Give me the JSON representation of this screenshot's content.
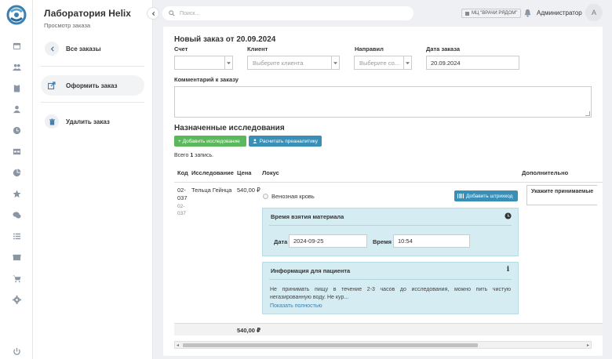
{
  "app": {
    "title": "Лаборатория Helix",
    "subtitle": "Просмотр заказа",
    "brand_color": "#3a7fb0"
  },
  "rail": {
    "icons": [
      "calendar-icon",
      "users-icon",
      "clipboard-icon",
      "user-icon",
      "clock-icon",
      "table-icon",
      "pie-chart-icon",
      "star-icon",
      "chat-icon",
      "list-icon",
      "box-icon",
      "cart-icon",
      "gear-icon",
      "power-icon"
    ]
  },
  "sidebar": {
    "back_label": "Все заказы",
    "submit_label": "Оформить заказ",
    "delete_label": "Удалить заказ"
  },
  "topbar": {
    "search_placeholder": "Поиск...",
    "org_label": "МЦ \"ВРАЧИ РЯДОМ\"",
    "user_name": "Администратор",
    "avatar_letter": "А"
  },
  "order": {
    "title": "Новый заказ от 20.09.2024",
    "fields": {
      "account_label": "Счет",
      "account_value": "",
      "client_label": "Клиент",
      "client_placeholder": "Выберите клиента",
      "referrer_label": "Направил",
      "referrer_placeholder": "Выберите со...",
      "date_label": "Дата заказа",
      "date_value": "20.09.2024",
      "comment_label": "Комментарий к заказу"
    },
    "section_title": "Назначенные исследования",
    "add_study_button": "+ Добавить исследование",
    "preanalytics_button": "Расчитать преаналитику",
    "count_prefix": "Всего ",
    "count_value": "1",
    "count_suffix": " запись."
  },
  "table": {
    "columns": [
      "Код",
      "Исследование",
      "Цена",
      "Локус",
      "Дополнительно"
    ],
    "row": {
      "code_line1": "02-",
      "code_line2": "037",
      "code_sub1": "02-",
      "code_sub2": "037",
      "study": "Тельца Гейнца",
      "price": "540,00 ₽",
      "locus": "Венозная кровь",
      "barcode_button": "Добавить штрихкод",
      "extra": "Укажите принимаемые"
    },
    "total": "540,00 ₽"
  },
  "sample_panel": {
    "title": "Время взятия материала",
    "date_label": "Дата",
    "date_value": "2024-09-25",
    "time_label": "Время",
    "time_value": "10:54"
  },
  "info_panel": {
    "title": "Информация для пациента",
    "text": "Не принимать пищу в течение 2-3 часов до исследования, можно пить чистую негазированную воду. Не кур...",
    "link": "Показать полностью"
  }
}
